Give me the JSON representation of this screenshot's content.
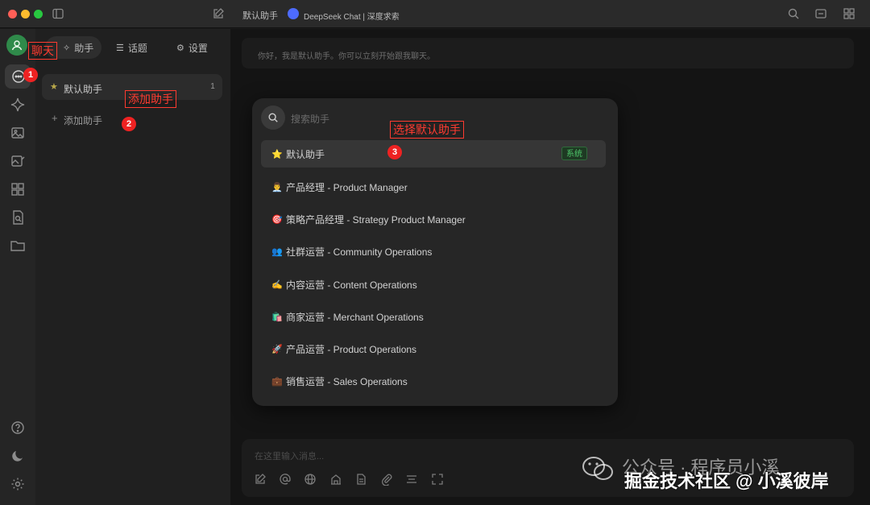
{
  "titlebar": {
    "assistant_name": "默认助手",
    "model_label": "DeepSeek Chat | 深度求索"
  },
  "sidebar": {
    "tabs": [
      {
        "label": "助手",
        "icon": "sparkle-icon"
      },
      {
        "label": "话题",
        "icon": "list-icon"
      },
      {
        "label": "设置",
        "icon": "gear-icon"
      }
    ],
    "assistant": {
      "label": "默认助手",
      "count": "1"
    },
    "add_label": "添加助手"
  },
  "main": {
    "greeting": "你好，我是默认助手。你可以立刻开始跟我聊天。",
    "input_placeholder": "在这里输入消息..."
  },
  "popup": {
    "search_placeholder": "搜索助手",
    "items": [
      {
        "emoji": "⭐",
        "label": "默认助手",
        "tag": "系统"
      },
      {
        "emoji": "👨‍💼",
        "label": "产品经理 - Product Manager"
      },
      {
        "emoji": "🎯",
        "label": "策略产品经理 - Strategy Product Manager"
      },
      {
        "emoji": "👥",
        "label": "社群运营 - Community Operations"
      },
      {
        "emoji": "✍️",
        "label": "内容运营 - Content Operations"
      },
      {
        "emoji": "🛍️",
        "label": "商家运营 - Merchant Operations"
      },
      {
        "emoji": "🚀",
        "label": "产品运营 - Product Operations"
      },
      {
        "emoji": "💼",
        "label": "销售运营 - Sales Operations"
      }
    ]
  },
  "annotations": {
    "chat": "聊天",
    "add": "添加助手",
    "select": "选择默认助手",
    "n1": "1",
    "n2": "2",
    "n3": "3"
  },
  "watermark": {
    "line1": "公众号 · 程序员小溪",
    "line2": "掘金技术社区 @ 小溪彼岸"
  },
  "colors": {
    "accent_green": "#2f8a4a",
    "annotation_red": "#ff3b30",
    "system_tag": "#4fc46a"
  }
}
